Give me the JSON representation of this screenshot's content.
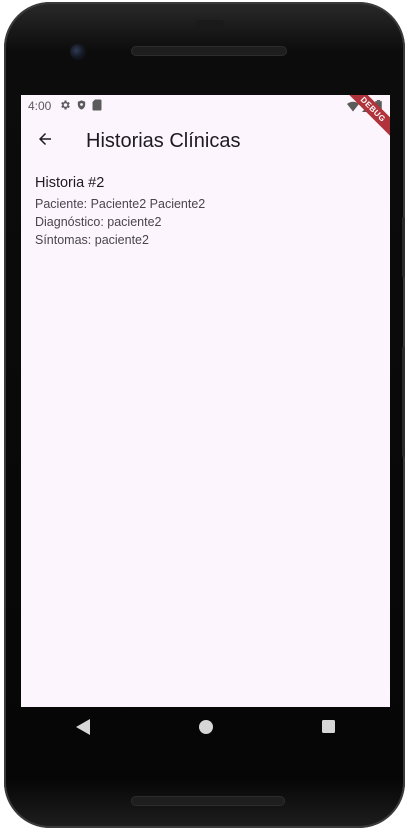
{
  "status_bar": {
    "time": "4:00",
    "icons_left": [
      "gear-icon",
      "shield-icon",
      "sd-card-icon"
    ],
    "icons_right": [
      "wifi-icon",
      "signal-icon",
      "battery-icon"
    ]
  },
  "debug_banner": {
    "label": "DEBUG",
    "color": "#b0323a"
  },
  "app_bar": {
    "back_icon": "arrow-back-icon",
    "title": "Historias Clínicas"
  },
  "record": {
    "title": "Historia #2",
    "patient": "Paciente: Paciente2 Paciente2",
    "diagnosis": "Diagnóstico: paciente2",
    "symptoms": "Síntomas: paciente2"
  },
  "nav_bar": {
    "buttons": [
      "back-triangle-icon",
      "home-circle-icon",
      "recents-square-icon"
    ]
  },
  "colors": {
    "screen_background": "#fcf5fd",
    "title_text": "#1d1b20",
    "body_text": "#49454f"
  }
}
